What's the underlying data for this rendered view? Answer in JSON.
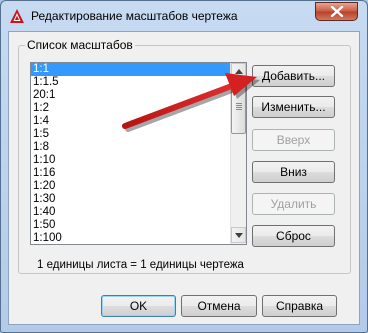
{
  "window": {
    "title": "Редактирование масштабов чертежа"
  },
  "group": {
    "title": "Список масштабов"
  },
  "scale_list": {
    "items": [
      "1:1",
      "1:1.5",
      "20:1",
      "1:2",
      "1:4",
      "1:5",
      "1:8",
      "1:10",
      "1:16",
      "1:20",
      "1:30",
      "1:40",
      "1:50",
      "1:100"
    ],
    "selected": "1:1"
  },
  "buttons": {
    "add": "Добавить...",
    "edit": "Изменить...",
    "up": "Вверх",
    "down": "Вниз",
    "delete": "Удалить",
    "reset": "Сброс",
    "ok": "OK",
    "cancel": "Отмена",
    "help": "Справка"
  },
  "info": "1 единицы листа = 1 единицы чертежа",
  "colors": {
    "selection": "#3399ff",
    "annotation_arrow": "#d42020"
  }
}
